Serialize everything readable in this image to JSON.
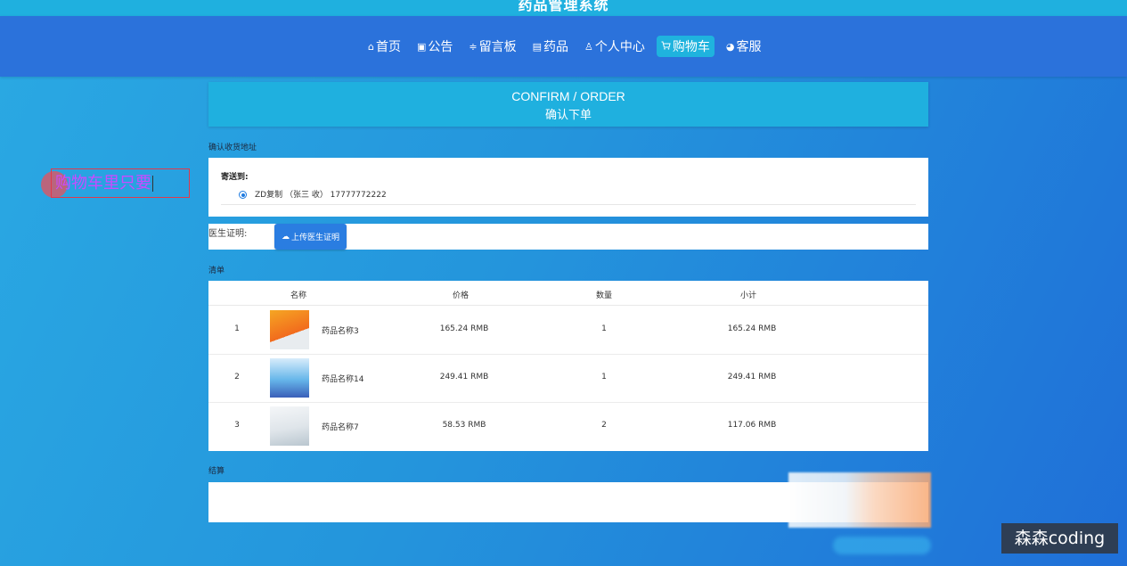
{
  "site": {
    "title": "药品管理系统"
  },
  "nav": {
    "items": [
      {
        "icon": "⌂",
        "icon_name": "home-icon",
        "label": "首页",
        "active": false
      },
      {
        "icon": "▣",
        "icon_name": "notice-icon",
        "label": "公告",
        "active": false
      },
      {
        "icon": "≑",
        "icon_name": "message-board-icon",
        "label": "留言板",
        "active": false
      },
      {
        "icon": "▤",
        "icon_name": "medicine-icon",
        "label": "药品",
        "active": false
      },
      {
        "icon": "♙",
        "icon_name": "user-icon",
        "label": "个人中心",
        "active": false
      },
      {
        "icon": "🛒",
        "icon_name": "cart-icon",
        "label": "购物车",
        "active": true
      },
      {
        "icon": "◕",
        "icon_name": "customer-service-icon",
        "label": "客服",
        "active": false
      }
    ]
  },
  "header": {
    "title_en": "CONFIRM / ORDER",
    "title_zh": "确认下单"
  },
  "address": {
    "section_label": "确认收货地址",
    "send_to_label": "寄送到:",
    "selected": "ZD复制 （张三 收） 17777772222"
  },
  "certificate": {
    "label": "医生证明:",
    "upload_button": "上传医生证明"
  },
  "list": {
    "section_label": "清单",
    "headers": {
      "name": "名称",
      "price": "价格",
      "quantity": "数量",
      "subtotal": "小计"
    },
    "rows": [
      {
        "index": "1",
        "name": "药品名称3",
        "price": "165.24 RMB",
        "quantity": "1",
        "subtotal": "165.24 RMB"
      },
      {
        "index": "2",
        "name": "药品名称14",
        "price": "249.41 RMB",
        "quantity": "1",
        "subtotal": "249.41 RMB"
      },
      {
        "index": "3",
        "name": "药品名称7",
        "price": "58.53 RMB",
        "quantity": "2",
        "subtotal": "117.06 RMB"
      }
    ]
  },
  "settlement": {
    "section_label": "结算"
  },
  "overlay": {
    "text": "购物车里只要"
  },
  "branding": {
    "text": "森森coding"
  },
  "colors": {
    "accent": "#1fb0df",
    "nav_bg": "#2b72db",
    "button": "#2a7de1"
  }
}
